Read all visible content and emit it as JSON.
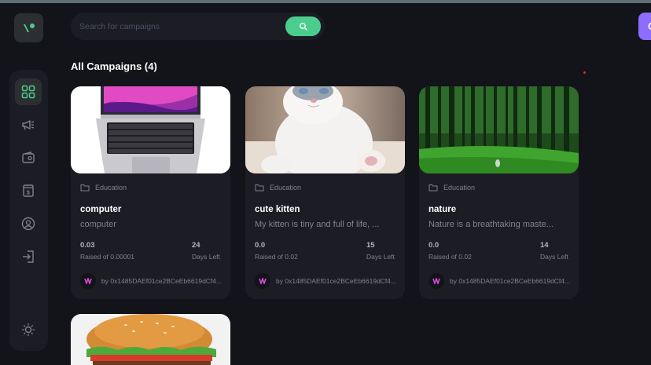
{
  "search": {
    "placeholder": "Search for campaigns"
  },
  "heading": "All Campaigns (4)",
  "nav": [
    {
      "name": "dashboard",
      "icon": "grid-icon",
      "active": true
    },
    {
      "name": "campaign",
      "icon": "megaphone-icon",
      "active": false
    },
    {
      "name": "payment",
      "icon": "wallet-icon",
      "active": false
    },
    {
      "name": "withdraw",
      "icon": "receipt-icon",
      "active": false
    },
    {
      "name": "profile",
      "icon": "user-icon",
      "active": false
    },
    {
      "name": "logout",
      "icon": "logout-icon",
      "active": false
    }
  ],
  "theme_icon": "sun-icon",
  "colors": {
    "accent": "#4acd8d",
    "secondary": "#8c6dfd",
    "bg": "#13131a",
    "card": "#1c1c24",
    "muted": "#808191"
  },
  "campaigns": [
    {
      "category": "Education",
      "title": "computer",
      "description": "computer",
      "raised": "0.03",
      "raised_label": "Raised of 0.00001",
      "days": "24",
      "days_label": "Days Left",
      "owner": "by 0x1485DAEf01ce2BCeEb6619dCf4..."
    },
    {
      "category": "Education",
      "title": "cute kitten",
      "description": "My kitten is tiny and full of life, ...",
      "raised": "0.0",
      "raised_label": "Raised of 0.02",
      "days": "15",
      "days_label": "Days Left",
      "owner": "by 0x1485DAEf01ce2BCeEb6619dCf4..."
    },
    {
      "category": "Education",
      "title": "nature",
      "description": "Nature is a breathtaking maste...",
      "raised": "0.0",
      "raised_label": "Raised of 0.02",
      "days": "14",
      "days_label": "Days Left",
      "owner": "by 0x1485DAEf01ce2BCeEb6619dCf4..."
    }
  ]
}
